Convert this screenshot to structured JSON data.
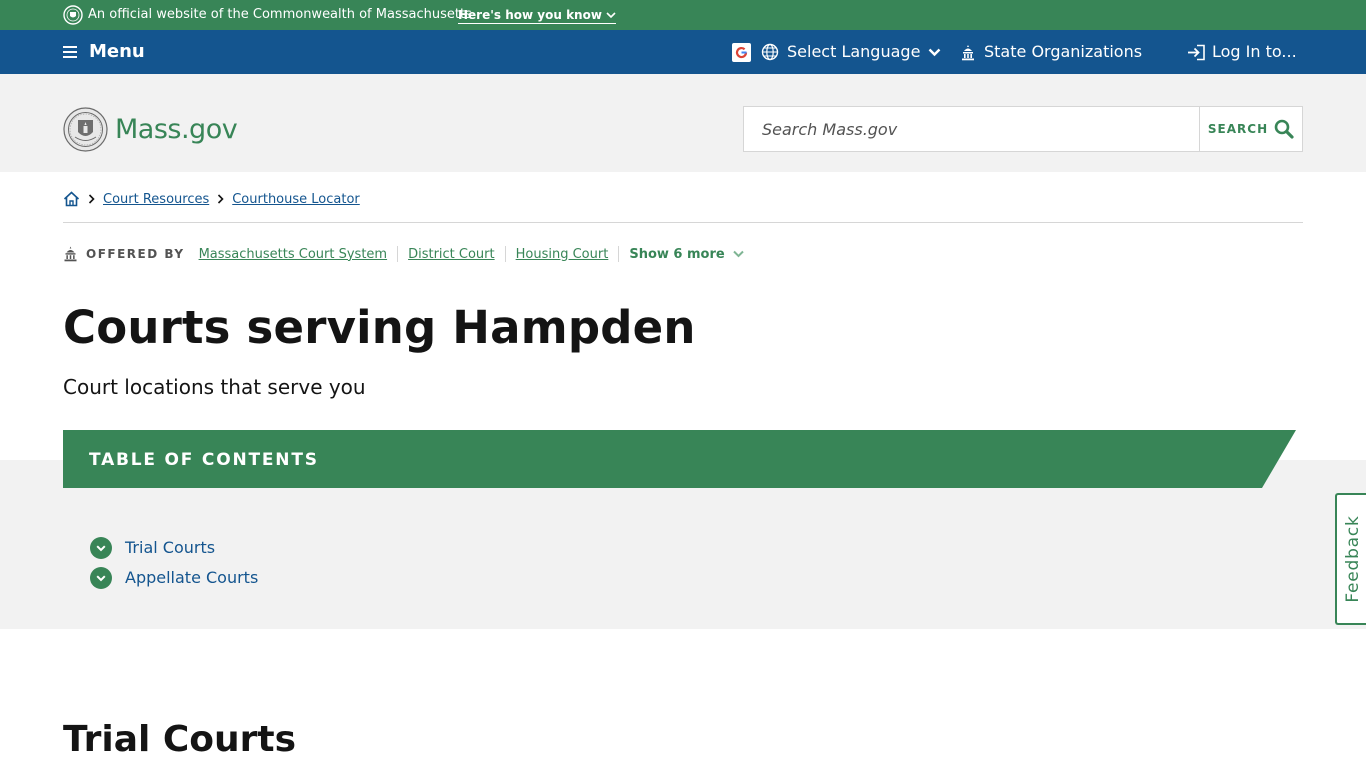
{
  "official_banner": {
    "text": "An official website of the Commonwealth of Massachusetts",
    "how_link": "Here's how you know"
  },
  "utility_nav": {
    "menu_label": "Menu",
    "language_label": "Select Language",
    "orgs_label": "State Organizations",
    "login_label": "Log In to..."
  },
  "header": {
    "site_name": "Mass.gov",
    "search_placeholder": "Search Mass.gov",
    "search_button": "SEARCH"
  },
  "breadcrumbs": {
    "items": [
      "Court Resources",
      "Courthouse Locator"
    ]
  },
  "offered_by": {
    "label": "OFFERED BY",
    "orgs": [
      "Massachusetts Court System",
      "District Court",
      "Housing Court"
    ],
    "more_label": "Show 6 more"
  },
  "page": {
    "title": "Courts serving Hampden",
    "subtitle": "Court locations that serve you"
  },
  "toc": {
    "heading": "TABLE OF CONTENTS",
    "items": [
      "Trial Courts",
      "Appellate Courts"
    ]
  },
  "feedback_label": "Feedback",
  "sections": [
    {
      "title": "Trial Courts"
    }
  ],
  "colors": {
    "green": "#388557",
    "blue": "#14558f",
    "header_bg": "#f2f2f2"
  }
}
